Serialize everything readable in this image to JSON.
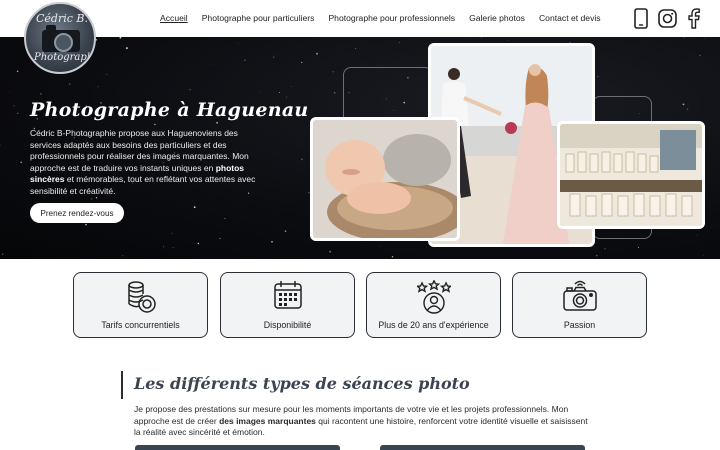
{
  "logo": {
    "line1": "Cédric B.",
    "line2": "Photographie"
  },
  "nav": {
    "items": [
      {
        "label": "Accueil",
        "active": true
      },
      {
        "label": "Photographe pour particuliers"
      },
      {
        "label": "Photographe pour professionnels"
      },
      {
        "label": "Galerie photos"
      },
      {
        "label": "Contact et devis"
      }
    ]
  },
  "social": [
    "phone-icon",
    "instagram-icon",
    "facebook-icon"
  ],
  "hero": {
    "title": "Photographe à Haguenau",
    "text_before": "Cédric B-Photographie propose aux Haguenoviens des services adaptés aux besoins des particuliers et des professionnels pour réaliser des images marquantes. Mon approche est de traduire vos instants uniques en ",
    "text_bold": "photos sincères",
    "text_after": " et mémorables, tout en reflétant vos attentes avec sensibilité et créativité.",
    "button": "Prenez rendez-vous"
  },
  "features": [
    {
      "label": "Tarifs concurrentiels",
      "icon": "coins-icon"
    },
    {
      "label": "Disponibilité",
      "icon": "calendar-icon"
    },
    {
      "label": "Plus de 20 ans d'expérience",
      "icon": "experience-stars-icon"
    },
    {
      "label": "Passion",
      "icon": "camera-icon"
    }
  ],
  "section": {
    "title": "Les différents types de séances photo",
    "text_before": "Je propose des prestations sur mesure pour les moments importants de votre vie et les projets professionnels. Mon approche est de créer ",
    "text_bold": "des images marquantes",
    "text_after": " qui racontent une histoire, renforcent votre identité visuelle et saisissent la réalité avec sincérité et émotion."
  },
  "colors": {
    "accent": "#3a4552",
    "card_bg": "#f2f3f4",
    "hero_bg": "#0b0c10"
  }
}
